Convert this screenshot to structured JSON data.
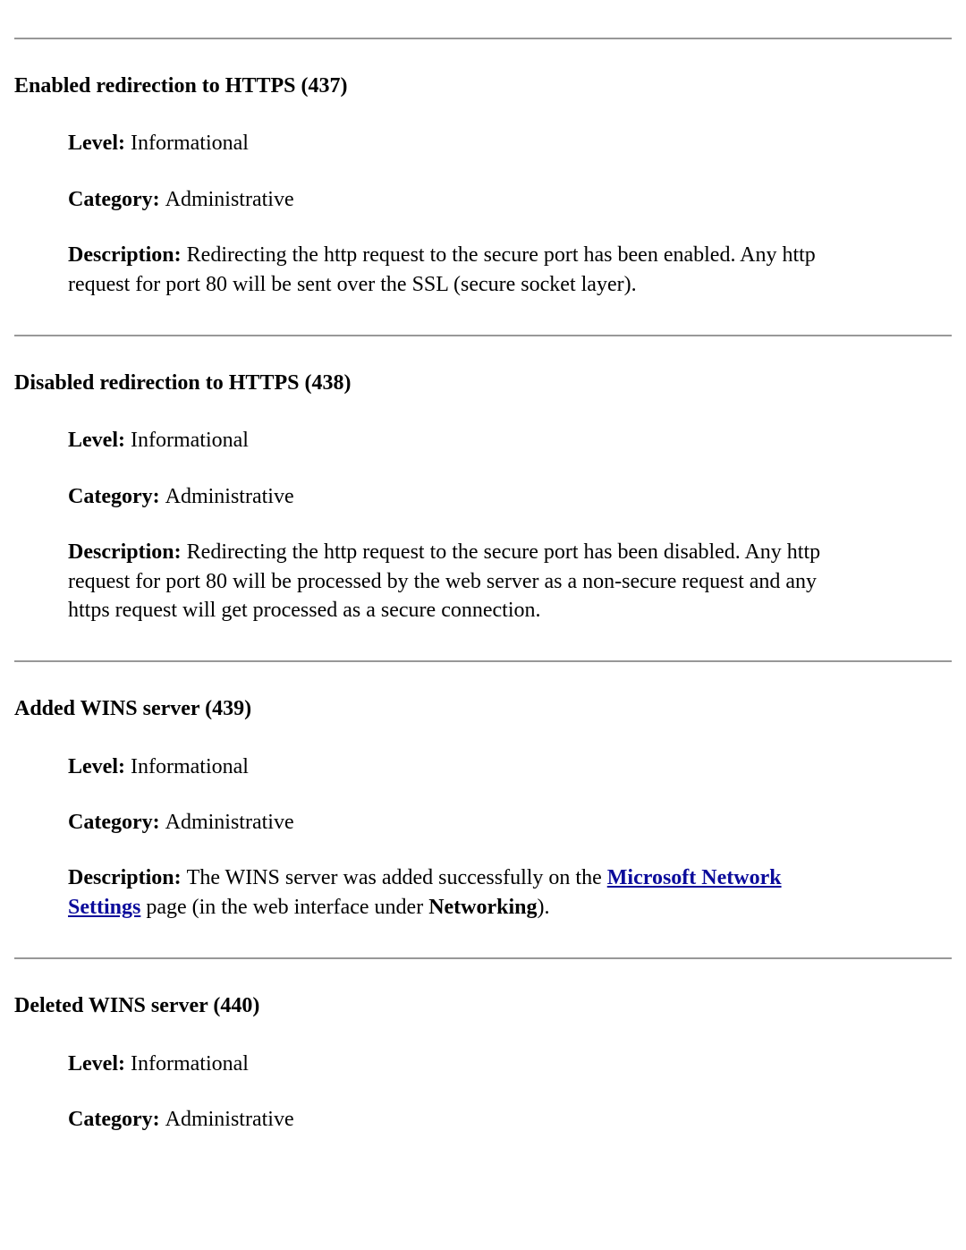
{
  "labels": {
    "level": "Level:",
    "category": "Category:",
    "description": "Description:"
  },
  "entries": [
    {
      "title": "Enabled redirection to HTTPS (437)",
      "level": "Informational",
      "category": "Administrative",
      "description_segments": [
        {
          "type": "text",
          "text": "Redirecting the http request to the secure port has been enabled. Any http request for port 80 will be sent over the SSL (secure socket layer)."
        }
      ]
    },
    {
      "title": "Disabled redirection to HTTPS (438)",
      "level": "Informational",
      "category": "Administrative",
      "description_segments": [
        {
          "type": "text",
          "text": "Redirecting the http request to the secure port has been disabled. Any http request for port 80 will be processed by the web server as a non-secure request and any https request will get processed as a secure connection."
        }
      ]
    },
    {
      "title": "Added WINS server (439)",
      "level": "Informational",
      "category": "Administrative",
      "description_segments": [
        {
          "type": "text",
          "text": "The WINS server was added successfully on the "
        },
        {
          "type": "link",
          "text": "Microsoft Network Settings"
        },
        {
          "type": "text",
          "text": " page (in the web interface under "
        },
        {
          "type": "bold",
          "text": "Networking"
        },
        {
          "type": "text",
          "text": ")."
        }
      ]
    },
    {
      "title": "Deleted WINS server (440)",
      "level": "Informational",
      "category": "Administrative",
      "description_segments": null
    }
  ]
}
